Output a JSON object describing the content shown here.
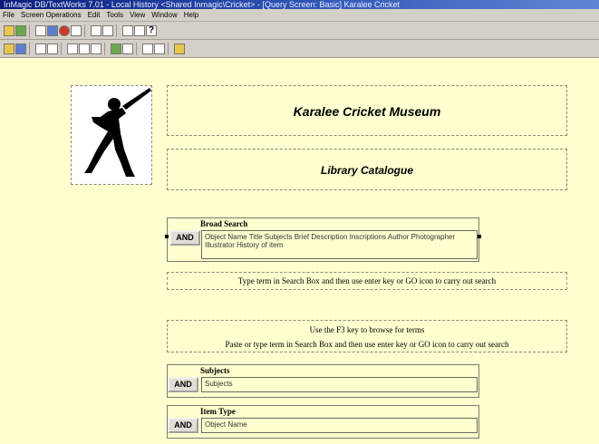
{
  "window": {
    "title": "InMagic DB/TextWorks 7.01 - Local History <Shared Inmagic\\Cricket> - [Query Screen: Basic] Karalee Cricket"
  },
  "menu": [
    "File",
    "Screen Operations",
    "Edit",
    "Tools",
    "View",
    "Window",
    "Help"
  ],
  "header": {
    "museum_name": "Karalee Cricket Museum",
    "catalogue_title": "Library Catalogue"
  },
  "broad_search": {
    "label": "Broad Search",
    "and_label": "AND",
    "value": "Object Name Title Subjects Brief Description Inscriptions Author Photographer Illustrator History of item"
  },
  "instructions": {
    "line1": "Type term in Search Box and then use enter key or GO icon to carry out search",
    "line2": "Use the F3 key to browse for terms",
    "line3": "Paste or type term in Search Box and then use enter key or GO icon to carry out search"
  },
  "subjects": {
    "label": "Subjects",
    "and_label": "AND",
    "value": "Subjects"
  },
  "item_type": {
    "label": "Item Type",
    "and_label": "AND",
    "value": "Object Name"
  }
}
